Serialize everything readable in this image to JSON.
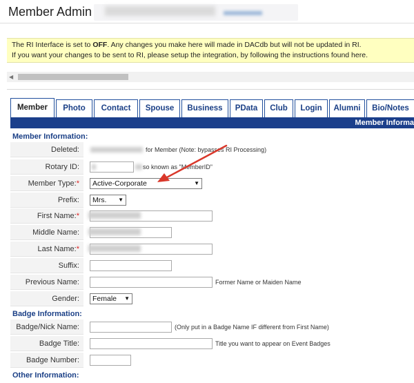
{
  "header": {
    "title": "Member Admin"
  },
  "ri_notice": {
    "line1_prefix": "The RI Interface is set to ",
    "line1_status": "OFF",
    "line1_suffix": ". Any changes you make here will made in DACdb but will not be updated in RI.",
    "line2": "If you want your changes to be sent to RI, please setup the integration, by following the instructions found here."
  },
  "tabs": [
    {
      "label": "Member",
      "active": true
    },
    {
      "label": "Photo"
    },
    {
      "label": "Contact"
    },
    {
      "label": "Spouse"
    },
    {
      "label": "Business"
    },
    {
      "label": "PData"
    },
    {
      "label": "Club"
    },
    {
      "label": "Login"
    },
    {
      "label": "Alumni"
    },
    {
      "label": "Bio/Notes"
    }
  ],
  "section_band": "Member Informa",
  "sections": {
    "member_info": "Member Information:",
    "badge_info": "Badge Information:",
    "other_info": "Other Information:"
  },
  "fields": {
    "deleted": {
      "label": "Deleted:",
      "note": "for Member (Note: bypasses RI Processing)"
    },
    "rotary_id": {
      "label": "Rotary ID:",
      "note": "so known as \"MemberID\""
    },
    "member_type": {
      "label": "Member Type:",
      "value": "Active-Corporate",
      "required": true
    },
    "prefix": {
      "label": "Prefix:",
      "value": "Mrs."
    },
    "first_name": {
      "label": "First Name:",
      "required": true
    },
    "middle_name": {
      "label": "Middle Name:"
    },
    "last_name": {
      "label": "Last Name:",
      "required": true
    },
    "suffix": {
      "label": "Suffix:"
    },
    "previous_name": {
      "label": "Previous Name:",
      "note": "Former Name or Maiden Name"
    },
    "gender": {
      "label": "Gender:",
      "value": "Female"
    },
    "badge_nick": {
      "label": "Badge/Nick Name:",
      "note": "(Only put in a Badge Name IF different from First Name)"
    },
    "badge_title": {
      "label": "Badge Title:",
      "note": "Title you want to appear on Event Badges"
    },
    "badge_number": {
      "label": "Badge Number:"
    }
  },
  "required_marker": "*",
  "colors": {
    "accent": "#1b3f8b",
    "tab_text": "#1a3f86",
    "required": "#dd2222",
    "notice_bg": "#ffffc0",
    "annotation_arrow": "#d9382b"
  }
}
